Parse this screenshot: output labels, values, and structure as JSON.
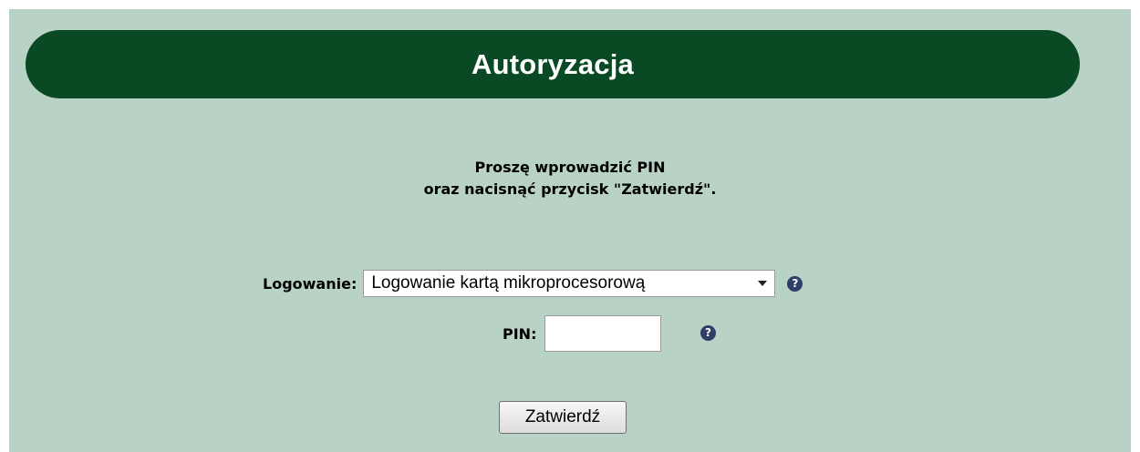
{
  "header": {
    "title": "Autoryzacja"
  },
  "instructions": {
    "line1": "Proszę wprowadzić PIN",
    "line2": "oraz nacisnąć przycisk \"Zatwierdź\"."
  },
  "login": {
    "label": "Logowanie:",
    "selected_value": "Logowanie kartą mikroprocesorową",
    "help_icon": "question-circle-icon",
    "help_glyph": "?"
  },
  "pin": {
    "label": "PIN:",
    "value": "",
    "help_icon": "question-circle-icon",
    "help_glyph": "?"
  },
  "submit": {
    "label": "Zatwierdź"
  },
  "colors": {
    "background": "#b9d2c6",
    "header": "#094923",
    "header_text": "#ffffff",
    "help_icon": "#2e3f68"
  }
}
